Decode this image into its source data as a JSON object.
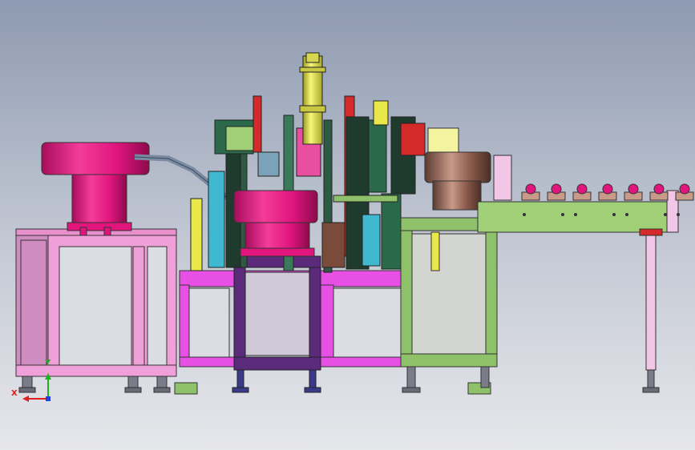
{
  "viewport": {
    "background_top": "#8e9ab1",
    "background_bottom": "#e6e7eb"
  },
  "colors": {
    "hopper_magenta": "#e0157e",
    "hopper_bronze": "#8a5a4a",
    "frame_pink": "#f0a0d8",
    "frame_magenta": "#e84fe4",
    "frame_purple": "#5c2a7a",
    "frame_green": "#8fc06a",
    "rail_green": "#9fd078",
    "column_yellow": "#e8e84a",
    "column_dark": "#1e3b2e",
    "accent_red": "#d42a2a",
    "accent_cyan": "#3fb8d0",
    "cabinet_pink": "#f2c6e6",
    "panel_lemon": "#f4f4a0",
    "foot_gray": "#7b7b8a"
  },
  "axis_triad": {
    "x_label": "X",
    "y_label": "Y",
    "x_color": "#e02020",
    "y_color": "#20b020",
    "z_color": "#2040e0"
  },
  "parts_count": 7
}
